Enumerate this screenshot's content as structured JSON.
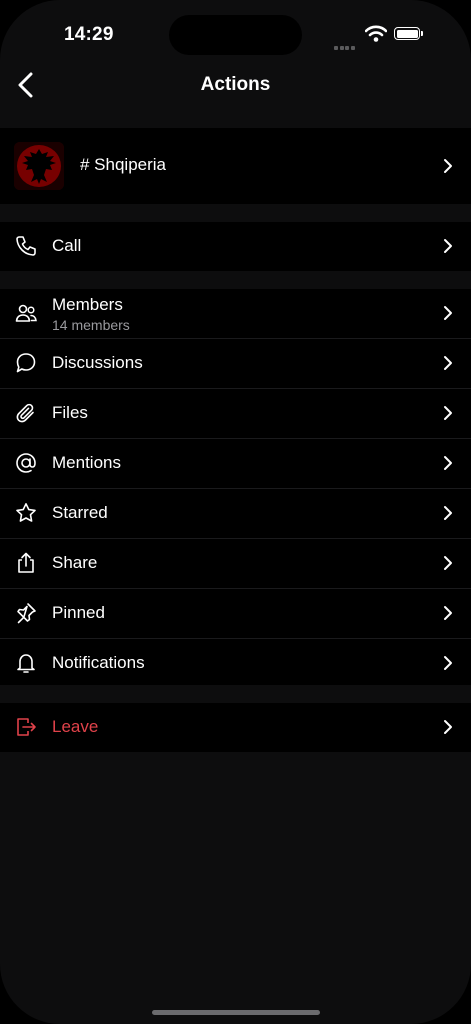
{
  "status": {
    "time": "14:29"
  },
  "nav": {
    "title": "Actions"
  },
  "channel": {
    "name": "# Shqiperia"
  },
  "call": {
    "label": "Call"
  },
  "members": {
    "label": "Members",
    "count": "14 members"
  },
  "items": [
    {
      "label": "Discussions",
      "icon": "discussions-icon"
    },
    {
      "label": "Files",
      "icon": "paperclip-icon"
    },
    {
      "label": "Mentions",
      "icon": "at-icon"
    },
    {
      "label": "Starred",
      "icon": "star-icon"
    },
    {
      "label": "Share",
      "icon": "share-icon"
    },
    {
      "label": "Pinned",
      "icon": "pin-icon"
    },
    {
      "label": "Notifications",
      "icon": "bell-icon"
    }
  ],
  "leave": {
    "label": "Leave"
  },
  "colors": {
    "accent_danger": "#e0424a",
    "background": "#0d0d0e",
    "group": "#000000"
  }
}
